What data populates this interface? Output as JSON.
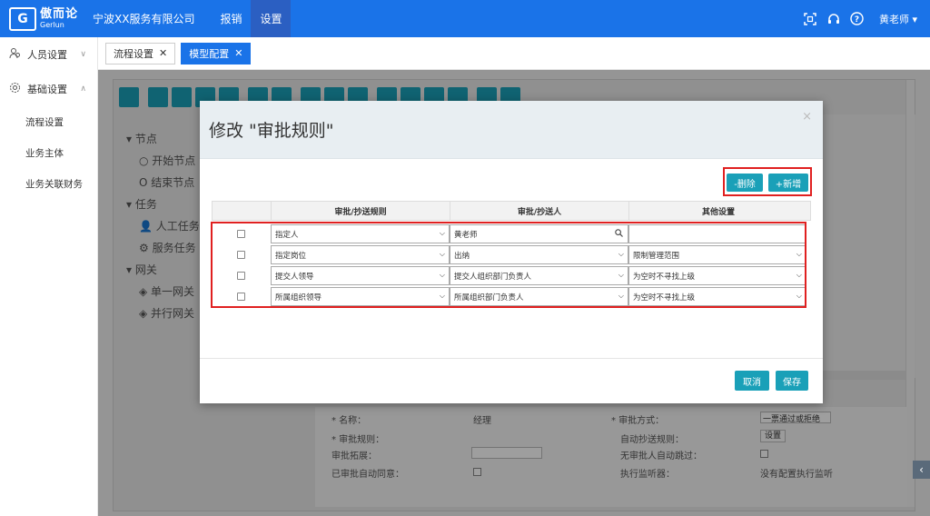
{
  "app": {
    "logo_mark": "G",
    "logo_cn": "傲而论",
    "logo_en": "Gerlun",
    "company": "宁波XX服务有限公司",
    "nav": [
      {
        "label": "报销"
      },
      {
        "label": "设置"
      }
    ],
    "user": "黄老师 ▾"
  },
  "sidebar": {
    "groups": [
      {
        "label": "人员设置",
        "chevron": "∨"
      },
      {
        "label": "基础设置",
        "chevron": "∧"
      }
    ],
    "items": [
      {
        "label": "流程设置"
      },
      {
        "label": "业务主体"
      },
      {
        "label": "业务关联财务"
      }
    ]
  },
  "tabs": [
    {
      "label": "流程设置",
      "close": "✕"
    },
    {
      "label": "模型配置",
      "close": "✕"
    }
  ],
  "designer": {
    "tree": [
      {
        "label": "▾ 节点"
      },
      {
        "label": "○ 开始节点"
      },
      {
        "label": "O 结束节点"
      },
      {
        "label": "▾ 任务"
      },
      {
        "label": "👤 人工任务"
      },
      {
        "label": "⚙ 服务任务"
      },
      {
        "label": "▾ 网关"
      },
      {
        "label": "◈ 单一网关"
      },
      {
        "label": "◈ 并行网关"
      }
    ],
    "props": {
      "name_label": "* 名称：",
      "name_value": "经理",
      "rule_label": "* 审批规则：",
      "expand_label": "审批拓展：",
      "auto_label": "已审批自动同意：",
      "mode_label": "* 审批方式：",
      "mode_value": "一票通过或拒绝",
      "cc_label": "自动抄送规则：",
      "cc_button": "设置",
      "skip_label": "无审批人自动跳过：",
      "listener_label": "执行监听器：",
      "listener_value": "没有配置执行监听"
    }
  },
  "modal": {
    "title": "修改 \"审批规则\"",
    "close": "×",
    "delete_button": "-删除",
    "add_button": "+新增",
    "columns": [
      "",
      "审批/抄送规则",
      "审批/抄送人",
      "其他设置"
    ],
    "rows": [
      {
        "rule": "指定人",
        "person": "黄老师",
        "person_type": "input",
        "other": ""
      },
      {
        "rule": "指定岗位",
        "person": "出纳",
        "person_type": "select",
        "other": "限制管理范围"
      },
      {
        "rule": "提交人领导",
        "person": "提交人组织部门负责人",
        "person_type": "select",
        "other": "为空时不寻找上级"
      },
      {
        "rule": "所属组织领导",
        "person": "所属组织部门负责人",
        "person_type": "select",
        "other": "为空时不寻找上级"
      }
    ],
    "cancel_button": "取消",
    "save_button": "保存"
  },
  "colors": {
    "primary": "#1a73e8",
    "teal": "#1aa0b8",
    "highlight": "#e02020"
  }
}
